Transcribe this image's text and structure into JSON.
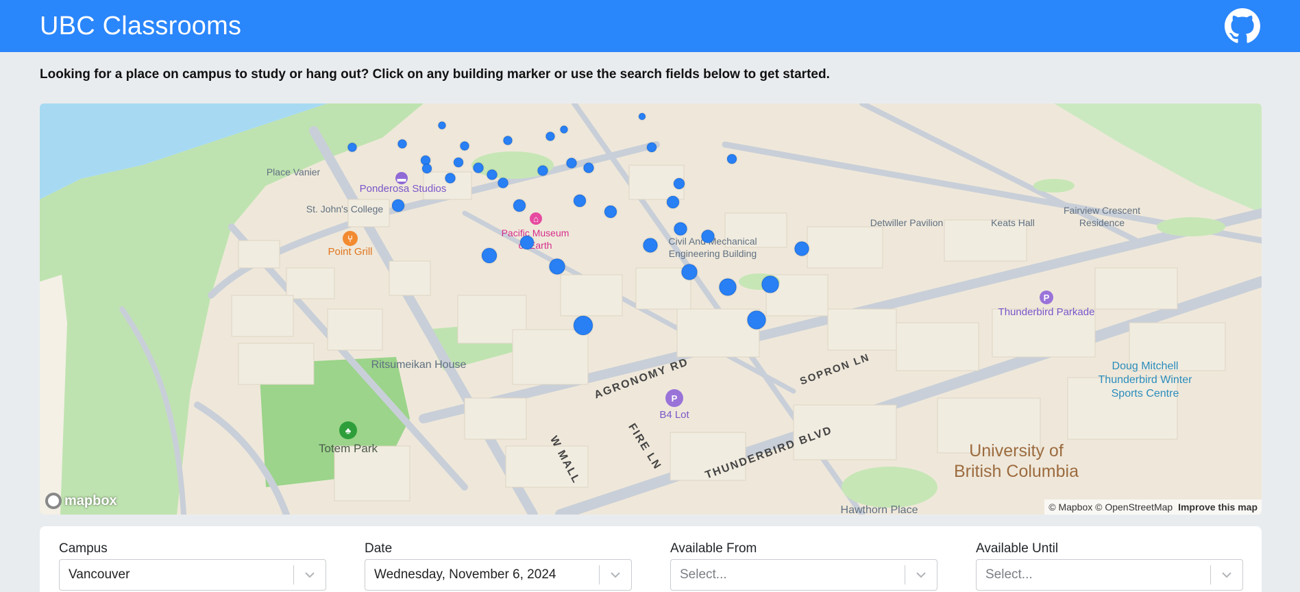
{
  "app": {
    "title": "UBC Classrooms",
    "github_icon": "github-icon",
    "accent": "#2a86fb"
  },
  "intro": {
    "text": "Looking for a place on campus to study or hang out? Click on any building marker or use the search fields below to get started."
  },
  "map": {
    "labels": {
      "place_vanier": "Place Vanier",
      "ponderosa": "Ponderosa Studios",
      "st_johns": "St. John's College",
      "point_grill": "Point Grill",
      "pacific_museum": "Pacific Museum\nof Earth",
      "civil_mech": "Civil And Mechanical\nEngineering Building",
      "detwiller": "Detwiller Pavilion",
      "keats": "Keats Hall",
      "fairview": "Fairview Crescent\nResidence",
      "thunderbird_parkade": "Thunderbird Parkade",
      "ritsumeikan": "Ritsumeikan House",
      "b4_lot": "B4 Lot",
      "totem_park": "Totem Park",
      "doug_mitchell": "Doug Mitchell\nThunderbird Winter\nSports Centre",
      "ubc": "University of\nBritish Columbia",
      "hawthorn": "Hawthorn Place"
    },
    "streets": {
      "agronomy": "AGRONOMY RD",
      "sopron": "SOPRON LN",
      "w_mall": "W MALL",
      "fire_ln": "FIRE LN",
      "thunderbird_blvd": "THUNDERBIRD BLVD"
    },
    "logo_text": "mapbox",
    "attribution": "© Mapbox © OpenStreetMap",
    "improve_link": "Improve this map",
    "marker_color": "#2980f5"
  },
  "form": {
    "campus": {
      "label": "Campus",
      "value": "Vancouver"
    },
    "date": {
      "label": "Date",
      "value": "Wednesday, November 6, 2024"
    },
    "available_from": {
      "label": "Available From",
      "placeholder": "Select..."
    },
    "available_until": {
      "label": "Available Until",
      "placeholder": "Select..."
    }
  }
}
